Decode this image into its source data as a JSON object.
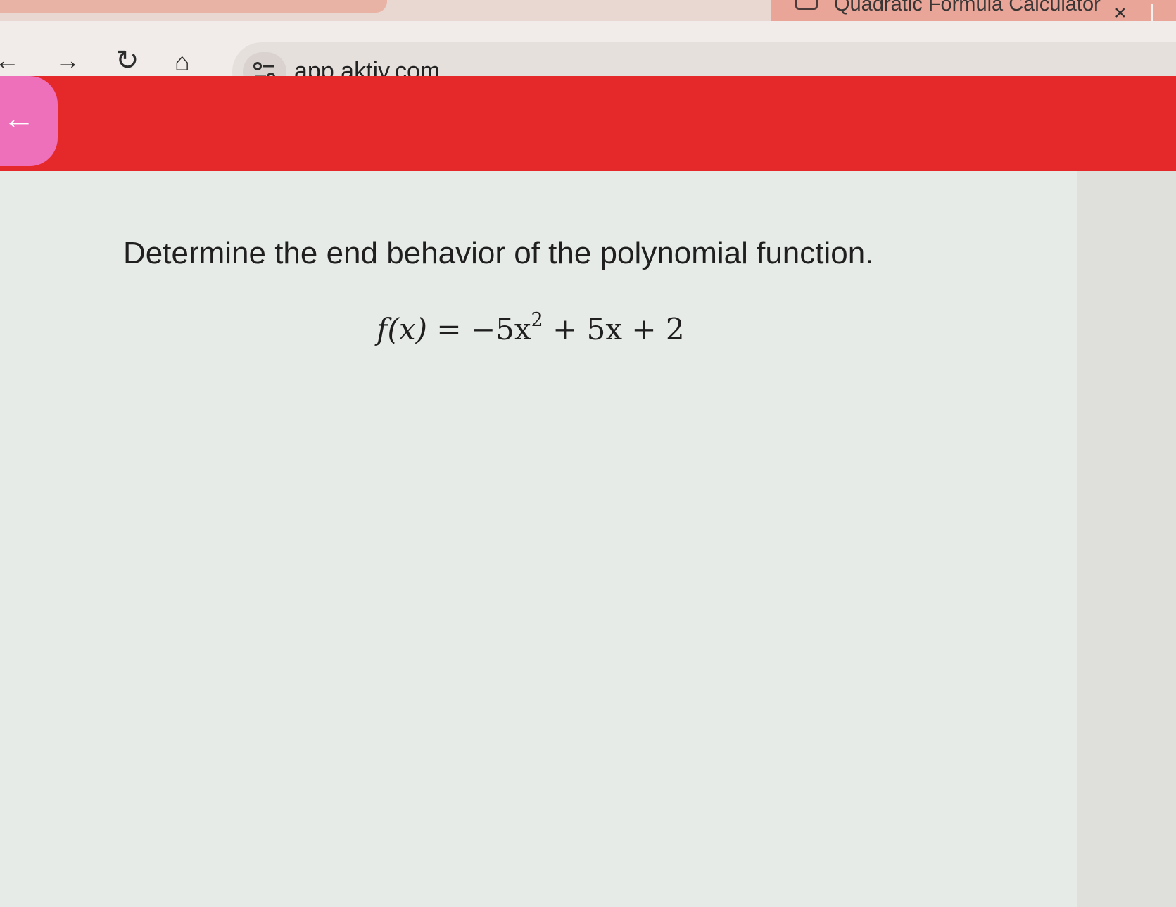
{
  "browser": {
    "tab": {
      "title": "Quadratic Formula Calculator",
      "close_label": "×"
    },
    "toolbar": {
      "back_icon": "←",
      "forward_icon": "→",
      "reload_icon": "↻",
      "home_icon": "⌂",
      "url": "app.aktiv.com"
    }
  },
  "app": {
    "header_color": "#e5282a",
    "back_icon": "←"
  },
  "question": {
    "prompt": "Determine the end behavior of the polynomial function.",
    "equation": {
      "lhs": "f(x)",
      "equals": "=",
      "term1": "−5x",
      "term1_exponent": "2",
      "rest": " + 5x + 2"
    }
  }
}
